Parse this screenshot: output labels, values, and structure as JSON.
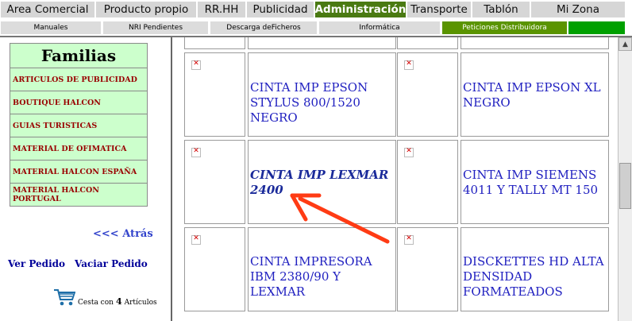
{
  "top_nav": {
    "items": [
      {
        "label": "Area Comercial"
      },
      {
        "label": "Producto propio"
      },
      {
        "label": "RR.HH"
      },
      {
        "label": "Publicidad"
      },
      {
        "label": "Administración"
      },
      {
        "label": "Transporte"
      },
      {
        "label": "Tablón"
      },
      {
        "label": "Mi Zona"
      }
    ],
    "active": "Administración",
    "active_color": "#4a7a12"
  },
  "sub_nav": {
    "items": [
      {
        "label": "Manuales"
      },
      {
        "label": "NRI Pendientes"
      },
      {
        "label": "Descarga deFicheros"
      },
      {
        "label": "Informática"
      },
      {
        "label": "Peticiones Distribuidora"
      }
    ],
    "active": "Peticiones Distribuidora",
    "active_color": "#5a9400"
  },
  "sidebar": {
    "title": "Familias",
    "families": [
      "ARTICULOS DE PUBLICIDAD",
      "BOUTIQUE HALCON",
      "GUIAS TURISTICAS",
      "MATERIAL DE OFIMATICA",
      "MATERIAL HALCON ESPAÑA",
      "MATERIAL HALCON PORTUGAL"
    ],
    "back_link": "<<< Atrás",
    "ver_pedido": "Ver Pedido",
    "vaciar_pedido": "Vaciar Pedido",
    "cart": {
      "prefix": "Cesta con",
      "count": "4",
      "suffix": "Artículos"
    }
  },
  "products": [
    {
      "name": "CINTA IMP EPSON STYLUS 800/1520 NEGRO",
      "image": "broken-image-icon"
    },
    {
      "name": "CINTA IMP EPSON XL NEGRO",
      "image": "broken-image-icon"
    },
    {
      "name": "CINTA IMP LEXMAR 2400",
      "image": "broken-image-icon",
      "selected": true
    },
    {
      "name": "CINTA IMP SIEMENS 4011 Y TALLY MT 150",
      "image": "broken-image-icon"
    },
    {
      "name": "CINTA IMPRESORA IBM 2380/90 Y LEXMAR",
      "image": "broken-image-icon"
    },
    {
      "name": "DISCKETTES HD ALTA DENSIDAD FORMATEADOS",
      "image": "broken-image-icon"
    }
  ],
  "annotation": {
    "type": "arrow",
    "color": "#ff3b14",
    "points_to": "CINTA IMP LEXMAR 2400"
  },
  "colors": {
    "family_bg": "#ccffcc",
    "family_text": "#990000",
    "product_link": "#2020c0"
  }
}
